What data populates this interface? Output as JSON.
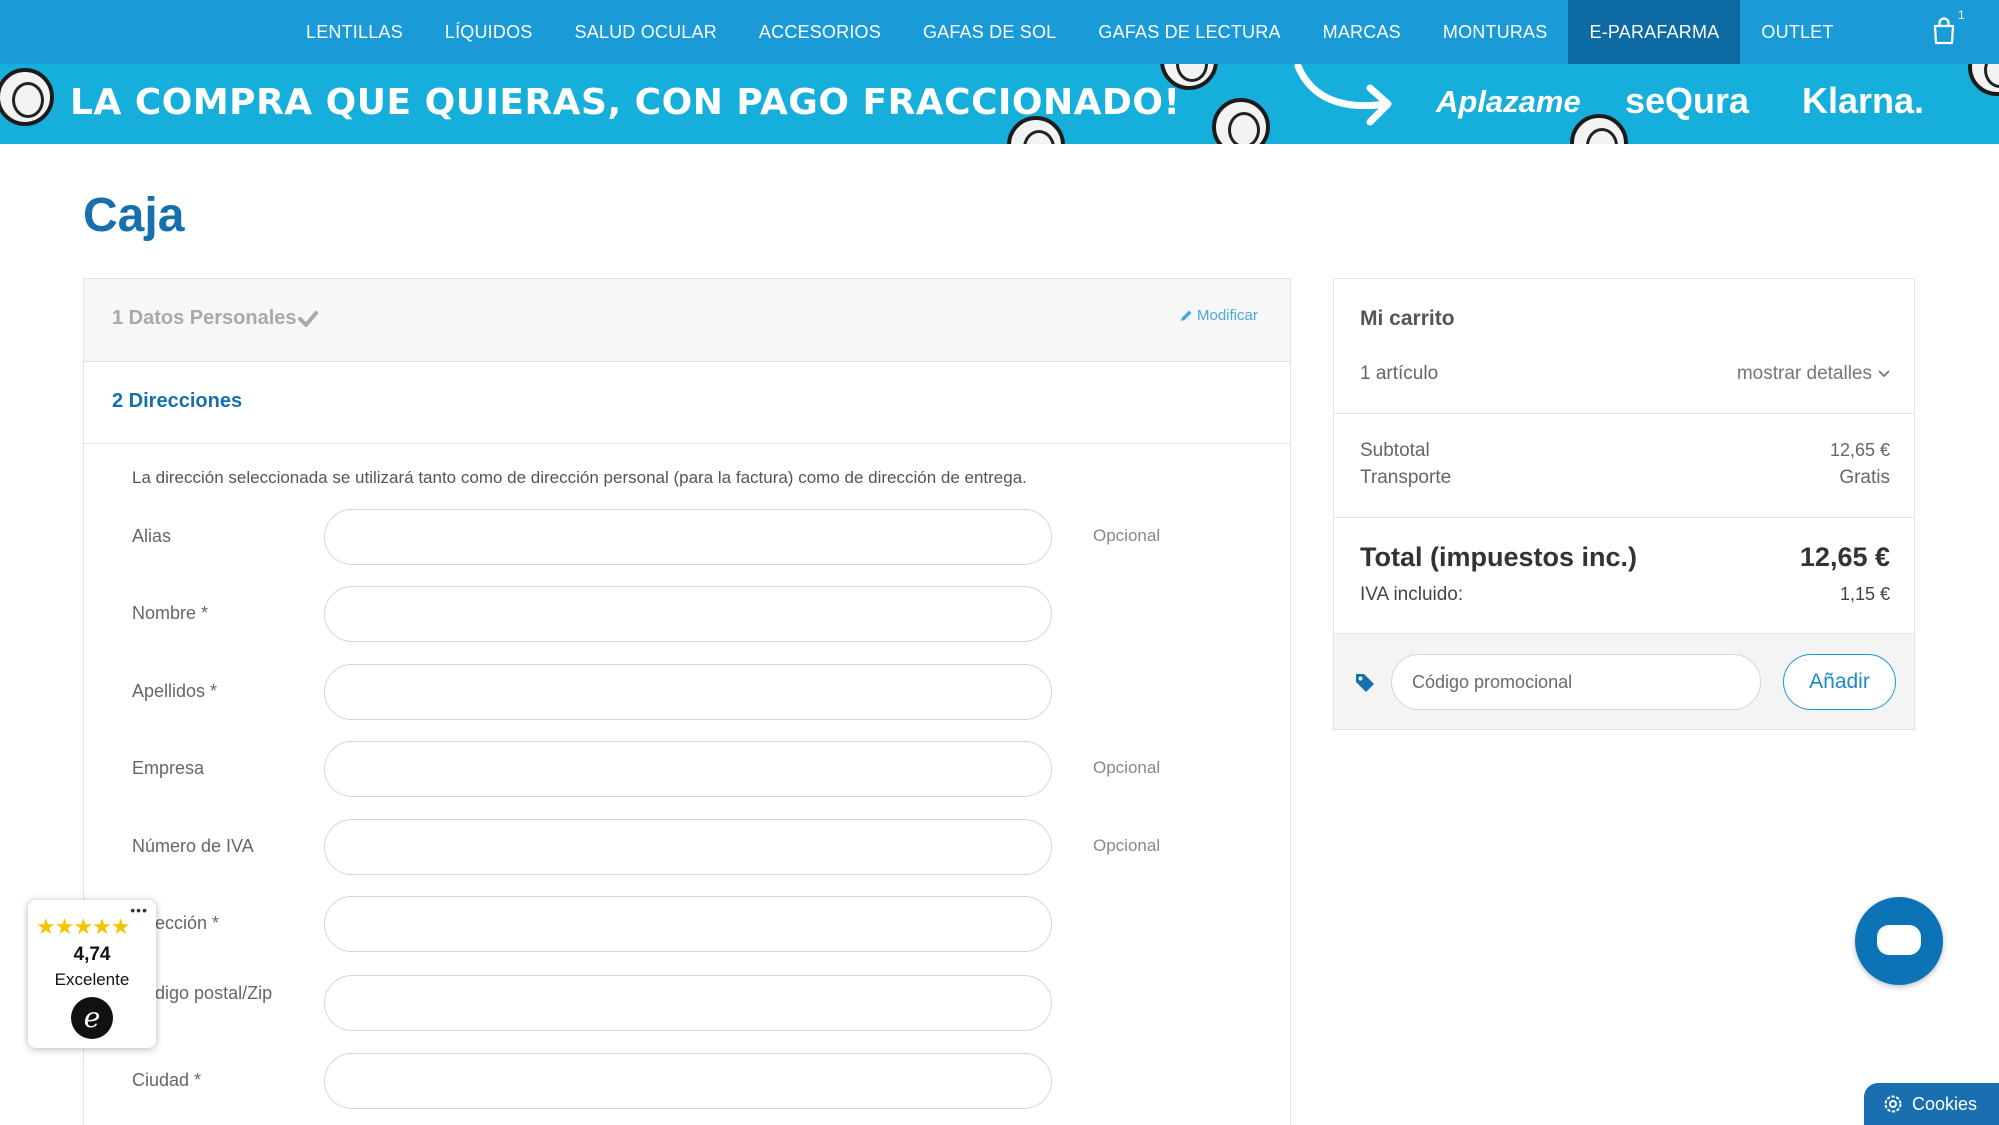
{
  "nav": {
    "items": [
      "LENTILLAS",
      "LÍQUIDOS",
      "SALUD OCULAR",
      "ACCESORIOS",
      "GAFAS DE SOL",
      "GAFAS DE LECTURA",
      "MARCAS",
      "MONTURAS",
      "E-PARAFARMA",
      "OUTLET"
    ],
    "active": "E-PARAFARMA",
    "cart_count": "1",
    "cart_icon": "shopping-bag-icon"
  },
  "banner": {
    "text": "LA COMPRA QUE QUIERAS, CON PAGO FRACCIONADO!",
    "brands": [
      "Aplazame",
      "seQura",
      "Klarna."
    ]
  },
  "page": {
    "title": "Caja"
  },
  "checkout": {
    "step1": {
      "title": "1 Datos Personales",
      "modify": "Modificar"
    },
    "step2": {
      "title": "2 Direcciones"
    },
    "note": "La dirección seleccionada se utilizará tanto como de dirección personal (para la factura) como de dirección de entrega.",
    "fields": [
      {
        "label": "Alias",
        "optional": "Opcional"
      },
      {
        "label": "Nombre *",
        "optional": ""
      },
      {
        "label": "Apellidos *",
        "optional": ""
      },
      {
        "label": "Empresa",
        "optional": "Opcional"
      },
      {
        "label": "Número de IVA",
        "optional": "Opcional"
      },
      {
        "label": "Dirección *",
        "optional": ""
      },
      {
        "label": "Código postal/Zip",
        "optional": ""
      },
      {
        "label": "Ciudad *",
        "optional": ""
      }
    ]
  },
  "cart": {
    "title": "Mi carrito",
    "items": "1 artículo",
    "details": "mostrar detalles",
    "subtotal_label": "Subtotal",
    "subtotal": "12,65 €",
    "shipping_label": "Transporte",
    "shipping": "Gratis",
    "total_label": "Total (impuestos inc.)",
    "total": "12,65 €",
    "iva_label": "IVA incluido:",
    "iva": "1,15 €",
    "promo_placeholder": "Código promocional",
    "promo_button": "Añadir"
  },
  "trust": {
    "score": "4,74",
    "label": "Excelente",
    "stars": "★★★★★"
  },
  "cookies": {
    "label": "Cookies"
  },
  "colors": {
    "nav": "#1a9ad6",
    "nav_active": "#0d6aa3",
    "banner": "#16aedb",
    "title": "#1570ad",
    "chat": "#0c74b6",
    "stars": "#f4c400"
  }
}
